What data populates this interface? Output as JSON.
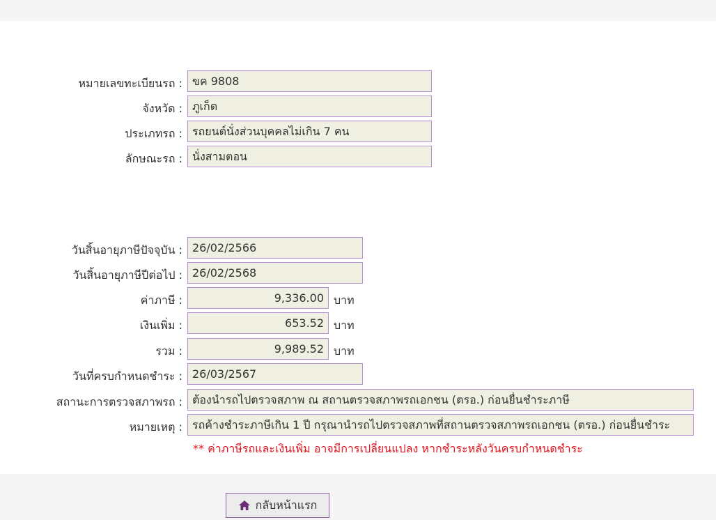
{
  "vehicle": {
    "plate_label": "หมายเลขทะเบียนรถ :",
    "plate_value": "ขค 9808",
    "province_label": "จังหวัด :",
    "province_value": "ภูเก็ต",
    "type_label": "ประเภทรถ :",
    "type_value": "รถยนต์นั่งส่วนบุคคลไม่เกิน 7 คน",
    "style_label": "ลักษณะรถ :",
    "style_value": "นั่งสามตอน"
  },
  "tax": {
    "current_expiry_label": "วันสิ้นอายุภาษีปัจจุบัน :",
    "current_expiry_value": "26/02/2566",
    "next_expiry_label": "วันสิ้นอายุภาษีปีต่อไป :",
    "next_expiry_value": "26/02/2568",
    "tax_label": "ค่าภาษี :",
    "tax_value": "9,336.00",
    "surcharge_label": "เงินเพิ่ม :",
    "surcharge_value": "653.52",
    "total_label": "รวม :",
    "total_value": "9,989.52",
    "currency_unit": "บาท",
    "due_date_label": "วันที่ครบกำหนดชำระ :",
    "due_date_value": "26/03/2567",
    "inspection_label": "สถานะการตรวจสภาพรถ :",
    "inspection_value": "ต้องนำรถไปตรวจสภาพ ณ สถานตรวจสภาพรถเอกชน (ตรอ.) ก่อนยื่นชำระภาษี",
    "remark_label": "หมายเหตุ :",
    "remark_value": "รถค้างชำระภาษีเกิน 1 ปี กรุณานำรถไปตรวจสภาพที่สถานตรวจสภาพรถเอกชน (ตรอ.) ก่อนยื่นชำระ",
    "warning_note": "** ค่าภาษีรถและเงินเพิ่ม อาจมีการเปลี่ยนแปลง หากชำระหลังวันครบกำหนดชำระ"
  },
  "actions": {
    "home_label": "กลับหน้าแรก",
    "home_icon": "home-icon"
  },
  "colors": {
    "field_bg": "#efefe2",
    "field_border": "#b58fd6",
    "warning": "#e0141e",
    "button_border": "#8a5a9a",
    "icon": "#6b2d73"
  }
}
